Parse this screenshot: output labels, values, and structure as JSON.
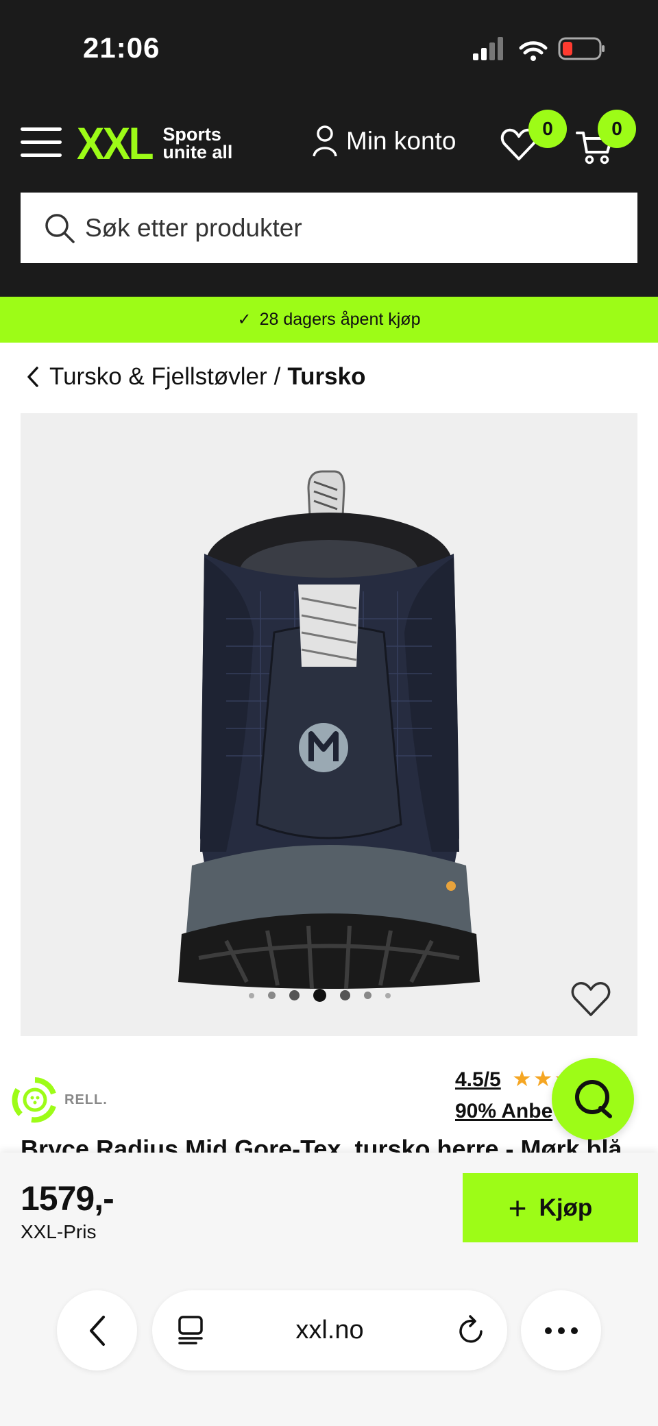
{
  "status_bar": {
    "time": "21:06"
  },
  "header": {
    "logo": {
      "mark": "XXL",
      "tagline_line1": "Sports",
      "tagline_line2": "unite all"
    },
    "account_label": "Min konto",
    "wishlist_count": "0",
    "cart_count": "0",
    "search_placeholder": "Søk etter produkter"
  },
  "promo": {
    "text": "28 dagers åpent kjøp"
  },
  "breadcrumb": {
    "parent": "Tursko & Fjellstøvler",
    "separator": "/",
    "current": "Tursko"
  },
  "gallery": {
    "total_images": 7,
    "active_index": 3
  },
  "product": {
    "brand_text": "RELL.",
    "rating_score": "4.5/5",
    "rating_value": 4.5,
    "recommend_text": "90% Anbe",
    "title": "Bryce Radius Mid Gore-Tex, tursko herre - Mørk blå"
  },
  "buy_bar": {
    "price": "1579,-",
    "price_label": "XXL-Pris",
    "buy_label": "Kjøp"
  },
  "browser": {
    "url": "xxl.no"
  },
  "colors": {
    "brand_green": "#9dfc17",
    "header_bg": "#1b1b1b",
    "star": "#f5a623"
  }
}
